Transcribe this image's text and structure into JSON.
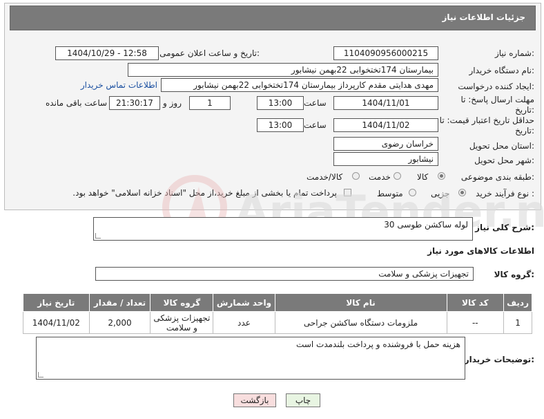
{
  "header": {
    "title": "جزئیات اطلاعات نیاز"
  },
  "form": {
    "need_number": {
      "label": "شماره نیاز:",
      "value": "1104090956000215"
    },
    "announce": {
      "label": "تاریخ و ساعت اعلان عمومی:",
      "value": "1404/10/29 - 12:58"
    },
    "buyer_org": {
      "label": "نام دستگاه خریدار:",
      "value": "بیمارستان 174تختخوابی 22بهمن نیشابور"
    },
    "requester": {
      "label": "ایجاد کننده درخواست:",
      "value": "مهدی هدایتی مقدم کارپرداز بیمارستان 174تختخوابی 22بهمن نیشابور",
      "contact_link": "اطلاعات تماس خریدار"
    },
    "reply_deadline": {
      "label": "مهلت ارسال پاسخ: تا تاریخ:",
      "date": "1404/11/01",
      "time_label": "ساعت",
      "time": "13:00",
      "days": "1",
      "days_label": "روز و",
      "remaining": "21:30:17",
      "remaining_label": "ساعت باقی مانده"
    },
    "price_deadline": {
      "label": "حداقل تاریخ اعتبار قیمت: تا تاریخ:",
      "date": "1404/11/02",
      "time_label": "ساعت",
      "time": "13:00"
    },
    "province": {
      "label": "استان محل تحویل:",
      "value": "خراسان رضوی"
    },
    "city": {
      "label": "شهر محل تحویل:",
      "value": "نیشابور"
    },
    "category": {
      "label": "طبقه بندی موضوعی:",
      "options": [
        "کالا",
        "خدمت",
        "کالا/خدمت"
      ],
      "selected": "کالا"
    },
    "process": {
      "label": "نوع فرآیند خرید :",
      "options": [
        "جزیی",
        "متوسط"
      ],
      "selected": "جزیی",
      "checkbox_text": "پرداخت تمام یا بخشی از مبلغ خرید،از محل \"اسناد خزانه اسلامی\" خواهد بود."
    }
  },
  "summary": {
    "label": "شرح کلی نیاز:",
    "value": "لوله ساکشن طوسی 30"
  },
  "goods_section": {
    "title": "اطلاعات کالاهای مورد نیاز"
  },
  "goods_group": {
    "label": "گروه کالا:",
    "value": "تجهیزات پزشکی و سلامت"
  },
  "table": {
    "headers": [
      "ردیف",
      "کد کالا",
      "نام کالا",
      "واحد شمارش",
      "گروه کالا",
      "تعداد / مقدار",
      "تاریخ نیاز"
    ],
    "rows": [
      [
        "1",
        "--",
        "ملزومات دستگاه ساکشن جراحی",
        "عدد",
        "تجهیزات پزشکی و سلامت",
        "2,000",
        "1404/11/02"
      ]
    ]
  },
  "buyer_notes": {
    "label": "توضیحات خریدار:",
    "value": "هزینه حمل با فروشنده و پرداخت بلندمدت است"
  },
  "buttons": {
    "print": "چاپ",
    "back": "بازگشت"
  },
  "colors": {
    "header_bg": "#7a7a7a",
    "link": "#1a4fa0",
    "print_bg": "#e8f5e2",
    "back_bg": "#f8dede"
  }
}
